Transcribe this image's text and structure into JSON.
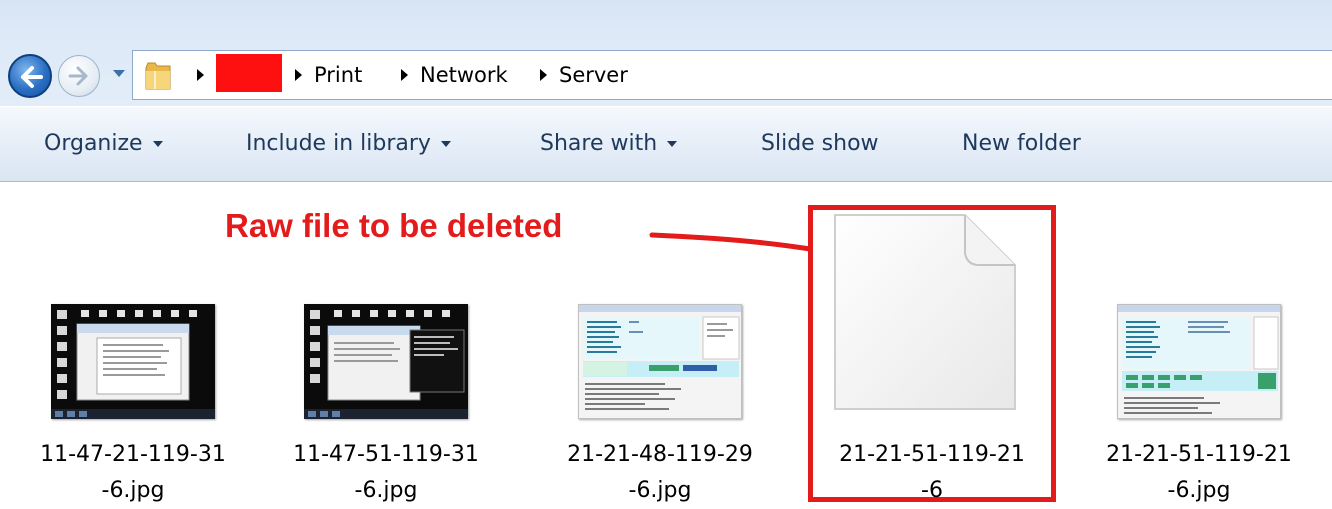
{
  "address_bar": {
    "breadcrumbs": [
      "Print",
      "Network",
      "Server"
    ]
  },
  "toolbar": {
    "organize": "Organize",
    "include_in_library": "Include in library",
    "share_with": "Share with",
    "slide_show": "Slide show",
    "new_folder": "New folder"
  },
  "annotation": {
    "text": "Raw file to be deleted",
    "color": "#e31b1b"
  },
  "files": [
    {
      "name_line1": "11-47-21-119-31",
      "name_line2": "-6.jpg",
      "thumb": "dark-desktop-screenshot"
    },
    {
      "name_line1": "11-47-51-119-31",
      "name_line2": "-6.jpg",
      "thumb": "dark-desktop-screenshot"
    },
    {
      "name_line1": "21-21-48-119-29",
      "name_line2": "-6.jpg",
      "thumb": "light-app-screenshot"
    },
    {
      "name_line1": "21-21-51-119-21",
      "name_line2": "-6",
      "thumb": "blank-document-icon"
    },
    {
      "name_line1": "21-21-51-119-21",
      "name_line2": "-6.jpg",
      "thumb": "light-app-screenshot"
    }
  ]
}
